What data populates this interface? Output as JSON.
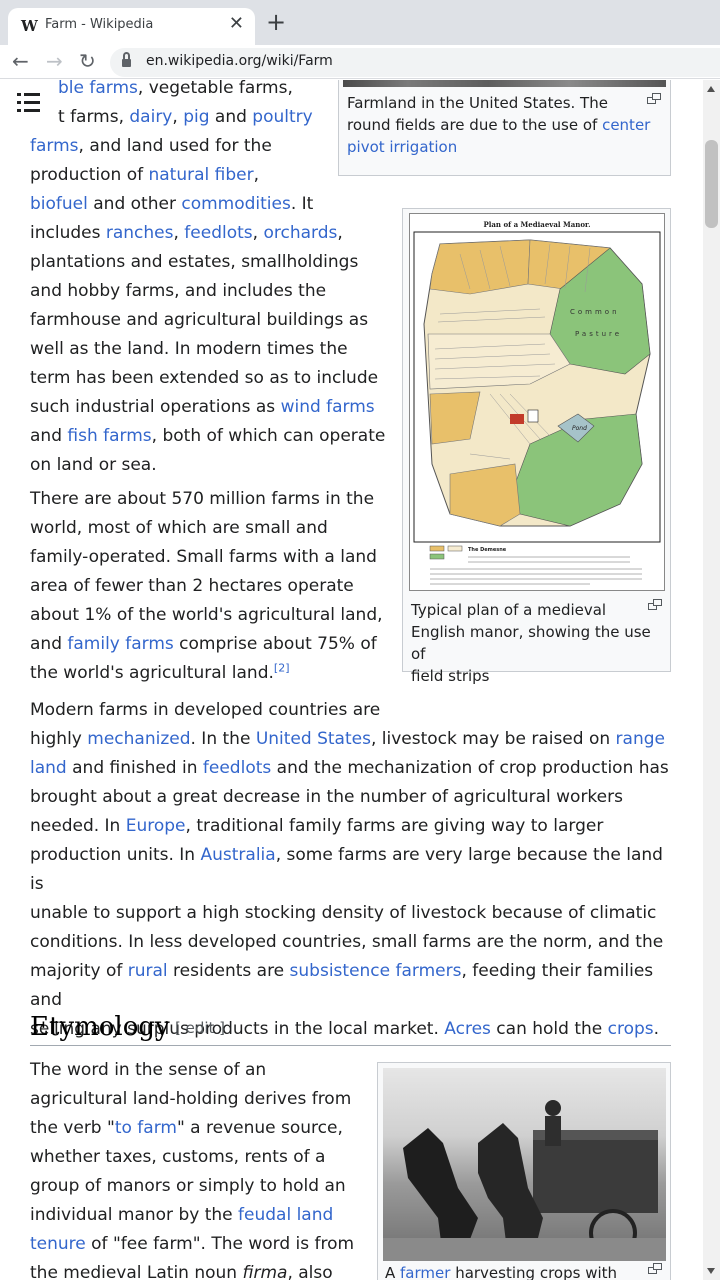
{
  "browser": {
    "tab_title": "Farm - Wikipedia",
    "favicon": "W",
    "url": "en.wikipedia.org/wiki/Farm",
    "icons": [
      "close-icon",
      "plus-icon",
      "back-arrow-icon",
      "forward-arrow-icon",
      "reload-icon",
      "lock-icon"
    ]
  },
  "article": {
    "para1_lines": [
      [
        "ble farms",
        ", vegetable farms,"
      ],
      [
        "t farms, ",
        "dairy",
        ", ",
        "pig",
        " and ",
        "poultry"
      ],
      [
        "farms",
        ", and land used for the"
      ],
      [
        "production of ",
        "natural fiber",
        ","
      ],
      [
        "biofuel",
        " and other ",
        "commodities",
        ". It"
      ],
      [
        "includes ",
        "ranches",
        ", ",
        "feedlots",
        ", ",
        "orchards",
        ","
      ],
      [
        "plantations and estates, smallholdings"
      ],
      [
        "and hobby farms, and includes the"
      ],
      [
        "farmhouse and agricultural buildings as"
      ],
      [
        "well as the land. In modern times the"
      ],
      [
        "term has been extended so as to include"
      ],
      [
        "such industrial operations as ",
        "wind farms"
      ],
      [
        "and ",
        "fish farms",
        ", both of which can operate"
      ],
      [
        "on land or sea."
      ]
    ],
    "para2_lines": [
      [
        "There are about 570 million farms in the"
      ],
      [
        "world, most of which are small and"
      ],
      [
        "family-operated. Small farms with a land"
      ],
      [
        "area of fewer than 2 hectares operate"
      ],
      [
        "about 1% of the world's agricultural land,"
      ],
      [
        "and ",
        "family farms",
        " comprise about 75% of"
      ],
      [
        "the world's agricultural land.",
        "[2]"
      ]
    ],
    "para3_lines": [
      [
        "Modern farms in developed countries are"
      ],
      [
        "highly ",
        "mechanized",
        ". In the ",
        "United States",
        ", livestock may be raised on ",
        "range"
      ],
      [
        "land",
        " and finished in ",
        "feedlots",
        " and the mechanization of crop production has"
      ],
      [
        "brought about a great decrease in the number of agricultural workers"
      ],
      [
        "needed. In ",
        "Europe",
        ", traditional family farms are giving way to larger"
      ],
      [
        "production units. In ",
        "Australia",
        ", some farms are very large because the land is"
      ],
      [
        "unable to support a high stocking density of livestock because of climatic"
      ],
      [
        "conditions. In less developed countries, small farms are the norm, and the"
      ],
      [
        "majority of ",
        "rural",
        " residents are ",
        "subsistence farmers",
        ", feeding their families and"
      ],
      [
        "selling any surplus products in the local market. ",
        "Acres",
        " can hold the ",
        "crops",
        "."
      ]
    ],
    "heading": "Etymology",
    "edit_label": "[ edit ]",
    "para4_lines": [
      [
        "The word in the sense of an"
      ],
      [
        "agricultural land-holding derives from"
      ],
      [
        "the verb \"",
        "to farm",
        "\" a revenue source,"
      ],
      [
        "whether taxes, customs, rents of a"
      ],
      [
        "group of manors or simply to hold an"
      ],
      [
        "individual manor by the ",
        "feudal land"
      ],
      [
        "tenure",
        " of \"fee farm\". The word is from"
      ],
      [
        "the medieval Latin noun ",
        "firma",
        ", also"
      ]
    ]
  },
  "figures": {
    "farmland_caption": [
      "Farmland in the United States. The",
      "round fields are due to the use of ",
      "center",
      "pivot irrigation"
    ],
    "manor_title": "Plan of a Mediaeval Manor.",
    "manor_labels": [
      "Common",
      "Pasture",
      "Pond",
      "Church",
      "Manor",
      "The Demesne"
    ],
    "manor_caption": [
      "Typical plan of a medieval",
      "English manor, showing the use of",
      "field strips"
    ],
    "farmer_caption": [
      "A ",
      "farmer",
      " harvesting crops with"
    ]
  }
}
